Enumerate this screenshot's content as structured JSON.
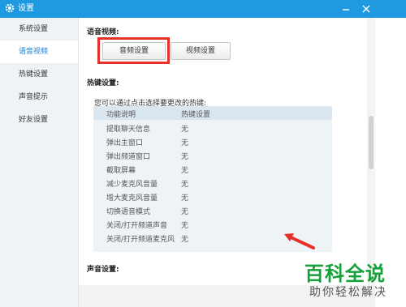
{
  "window": {
    "title": "设置",
    "icon": "gear-icon",
    "accent": "#1f9ae0"
  },
  "sidebar": {
    "items": [
      {
        "label": "系统设置",
        "active": false
      },
      {
        "label": "语音视频",
        "active": true
      },
      {
        "label": "热键设置",
        "active": false
      },
      {
        "label": "声音提示",
        "active": false
      },
      {
        "label": "好友设置",
        "active": false
      }
    ]
  },
  "voice_video": {
    "title": "语音视频:",
    "audio_button": "音频设置",
    "video_button": "视频设置"
  },
  "hotkeys": {
    "title": "热键设置:",
    "hint": "您可以通过点击选择要更改的热键:",
    "columns": [
      "功能说明",
      "热键设置"
    ],
    "rows": [
      {
        "func": "提取聊天信息",
        "key": "无"
      },
      {
        "func": "弹出主窗口",
        "key": "无"
      },
      {
        "func": "弹出频道窗口",
        "key": "无"
      },
      {
        "func": "截取屏幕",
        "key": "无"
      },
      {
        "func": "减少麦克风音量",
        "key": "无"
      },
      {
        "func": "增大麦克风音量",
        "key": "无"
      },
      {
        "func": "切换语音模式",
        "key": "无"
      },
      {
        "func": "关闭/打开频道声音",
        "key": "无"
      },
      {
        "func": "关闭/打开频道麦克风",
        "key": "无"
      }
    ]
  },
  "sound": {
    "title": "声音设置:"
  },
  "watermark": {
    "main": "百科全说",
    "sub": "助你轻松解决",
    "color": "#15a03a"
  },
  "highlight_color": "#e8302a"
}
